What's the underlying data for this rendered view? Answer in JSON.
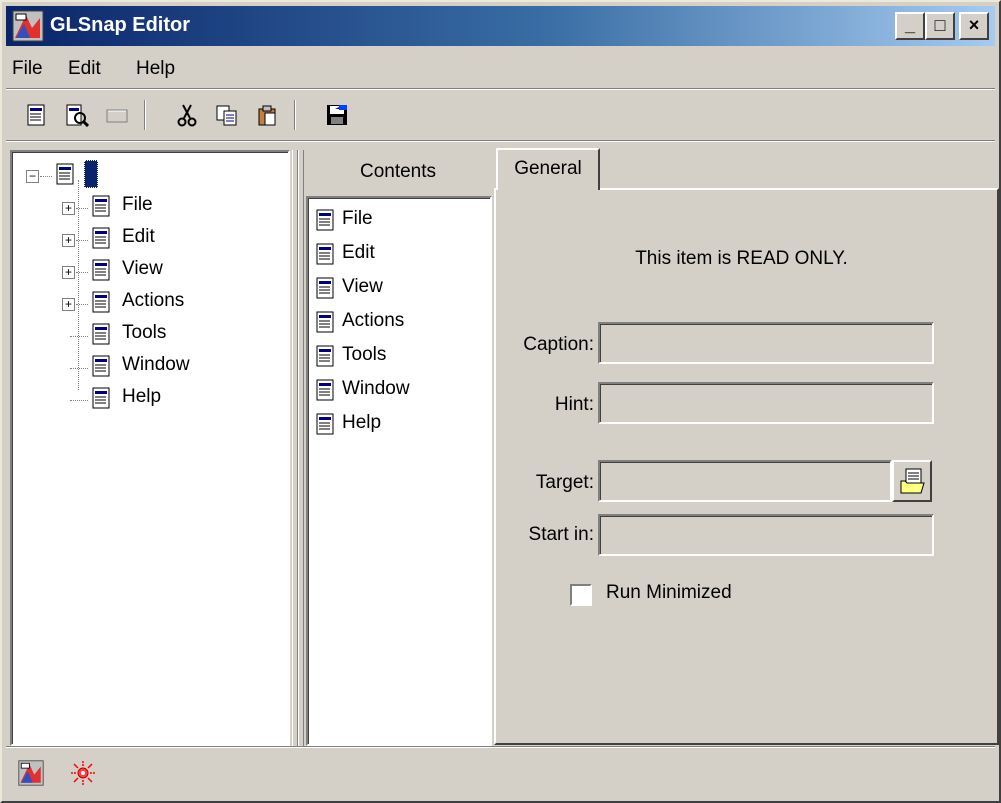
{
  "window": {
    "title": "GLSnap Editor"
  },
  "title_buttons": {
    "minimize": "_",
    "maximize": "□",
    "close": "×"
  },
  "menu": {
    "items": [
      "File",
      "Edit",
      "Help"
    ]
  },
  "toolbar": {
    "icons": [
      "new-item-icon",
      "properties-icon",
      "disabled-icon",
      "cut-icon",
      "copy-icon",
      "paste-icon",
      "save-icon"
    ]
  },
  "tree": {
    "root_label": "",
    "items": [
      {
        "label": "File",
        "expandable": true
      },
      {
        "label": "Edit",
        "expandable": true
      },
      {
        "label": "View",
        "expandable": true
      },
      {
        "label": "Actions",
        "expandable": true
      },
      {
        "label": "Tools",
        "expandable": false
      },
      {
        "label": "Window",
        "expandable": false
      },
      {
        "label": "Help",
        "expandable": false
      }
    ]
  },
  "contents": {
    "header": "Contents",
    "items": [
      "File",
      "Edit",
      "View",
      "Actions",
      "Tools",
      "Window",
      "Help"
    ]
  },
  "tabs": {
    "general": "General"
  },
  "general": {
    "readonly_message": "This item is READ ONLY.",
    "caption_label": "Caption:",
    "caption_value": "",
    "hint_label": "Hint:",
    "hint_value": "",
    "target_label": "Target:",
    "target_value": "",
    "startin_label": "Start in:",
    "startin_value": "",
    "run_minimized_label": "Run Minimized",
    "run_minimized_checked": false
  },
  "colors": {
    "face": "#d4d0c8",
    "title_start": "#0a246a",
    "title_end": "#a6caf0"
  }
}
